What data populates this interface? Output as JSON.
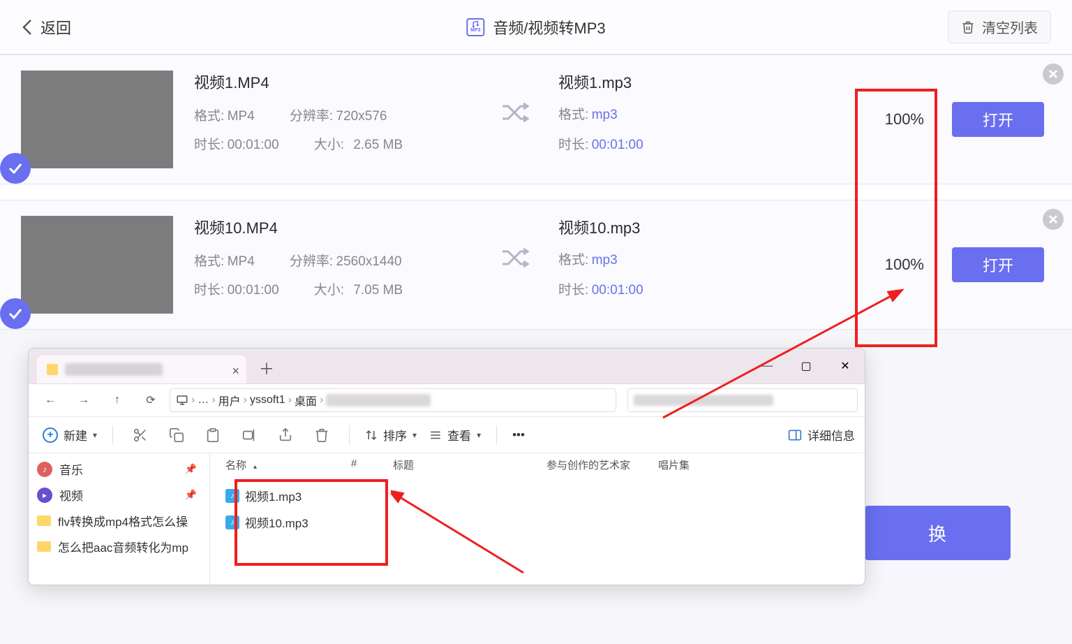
{
  "header": {
    "back": "返回",
    "title": "音频/视频转MP3",
    "clear": "清空列表"
  },
  "cards": [
    {
      "in_name": "视频1.MP4",
      "fmt_label": "格式:",
      "fmt_val": "MP4",
      "res_label": "分辨率:",
      "res_val": "720x576",
      "dur_label": "时长:",
      "dur_val": "00:01:00",
      "size_label": "大小:",
      "size_val": "2.65 MB",
      "out_name": "视频1.mp3",
      "out_fmt_label": "格式:",
      "out_fmt_val": "mp3",
      "out_dur_label": "时长:",
      "out_dur_val": "00:01:00",
      "pct": "100%",
      "open": "打开"
    },
    {
      "in_name": "视频10.MP4",
      "fmt_label": "格式:",
      "fmt_val": "MP4",
      "res_label": "分辨率:",
      "res_val": "2560x1440",
      "dur_label": "时长:",
      "dur_val": "00:01:00",
      "size_label": "大小:",
      "size_val": "7.05 MB",
      "out_name": "视频10.mp3",
      "out_fmt_label": "格式:",
      "out_fmt_val": "mp3",
      "out_dur_label": "时长:",
      "out_dur_val": "00:01:00",
      "pct": "100%",
      "open": "打开"
    }
  ],
  "explorer": {
    "breadcrumb": {
      "users": "用户",
      "acct": "yssoft1",
      "desktop": "桌面"
    },
    "toolbar": {
      "new": "新建",
      "sort": "排序",
      "view": "查看",
      "detail": "详细信息"
    },
    "cols": {
      "name": "名称",
      "num": "#",
      "title": "标题",
      "artist": "参与创作的艺术家",
      "album": "唱片集"
    },
    "side": {
      "music": "音乐",
      "video": "视频",
      "folder1": "flv转换成mp4格式怎么操",
      "folder2": "怎么把aac音频转化为mp"
    },
    "files": [
      "视频1.mp3",
      "视频10.mp3"
    ]
  },
  "convert_btn": "换"
}
